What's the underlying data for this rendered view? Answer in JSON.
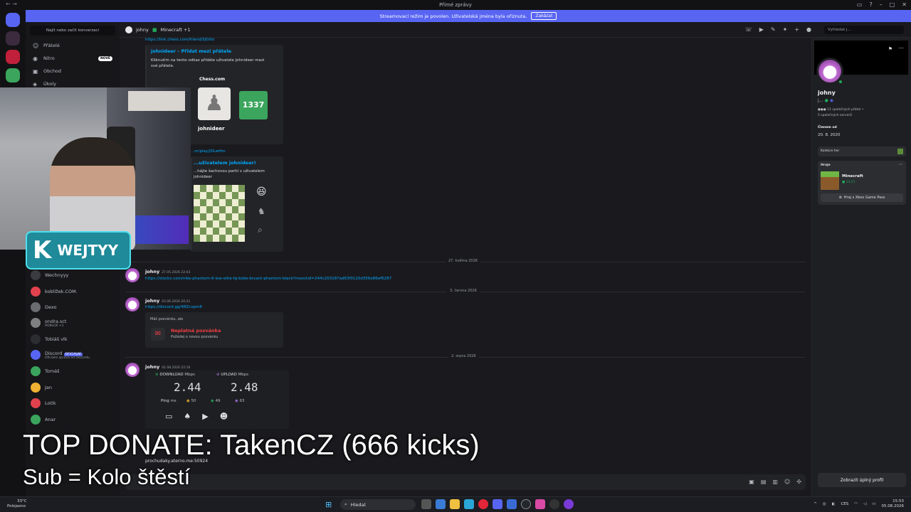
{
  "window": {
    "title": "Přímé zprávy"
  },
  "banner": {
    "text": "Streamovací režim je povolen. Uživatelská jména byla ořiznuta.",
    "button": "Zakázat"
  },
  "sidebar": {
    "search_placeholder": "Najít nebo začít konverzaci",
    "nav": [
      {
        "label": "Přátelé",
        "icon": "friends-icon"
      },
      {
        "label": "Nitro",
        "icon": "nitro-icon",
        "badge": "NOVÉ"
      },
      {
        "label": "Obchod",
        "icon": "shop-icon"
      },
      {
        "label": "Úkoly",
        "icon": "quests-icon"
      }
    ],
    "dms": [
      {
        "name": "Wechnyyy",
        "sub": "",
        "color": "#3a3b40"
      },
      {
        "name": "koblížek.COM.",
        "sub": "",
        "color": "#e0424d"
      },
      {
        "name": "Dexo",
        "sub": "",
        "color": "#6b6c70"
      },
      {
        "name": "ondra.sct",
        "sub": "ROBLOX +1",
        "color": "#7f8082"
      },
      {
        "name": "Tobiáš vlk",
        "sub": "",
        "color": "#2b2d31"
      },
      {
        "name": "Discord",
        "sub": "Oficiální zpráva od Discordu",
        "verified": "OFICIÁLNÍ",
        "color": "#5865f2"
      },
      {
        "name": "Tomáš",
        "sub": "",
        "color": "#3ba55d"
      },
      {
        "name": "Jan",
        "sub": "",
        "color": "#f0b232"
      },
      {
        "name": "Lotik",
        "sub": "",
        "color": "#e0424d"
      },
      {
        "name": "Anar",
        "sub": "",
        "color": "#3ba55d"
      }
    ]
  },
  "chat": {
    "recipient": "johny",
    "activity": "Minecraft +1",
    "search_placeholder": "Vyhledat j...",
    "messages": {
      "link1": "https://link.chess.com/friend/5JGtto",
      "embed1_title": "johnideer – Přidat mezi přátele",
      "embed1_text": "Kliknutím na tento odkaz přidáte uživatele johnideer mezi své přátele.",
      "chess_brand": "Chess.com",
      "chess_rating": "1337",
      "chess_user": "johnideer",
      "link2": "...m/play/jDLwHm",
      "embed2_title": "...uživatelem johnideer!",
      "embed2_text": "...hájte šachovou partii s uživatelem johnideer",
      "divider1": "27. května 2026",
      "msg2_author": "johny",
      "msg2_time": "27.05.2026 22:03",
      "msg2_link": "https://stockx.com/nike-phantom-6-low-elite-fg-kobe-bryant-phantom-black?msockid=244c203187ad63f0120d356e86ef6287",
      "divider2": "3. června 2026",
      "msg3_author": "johny",
      "msg3_time": "03.06.2026 20:21",
      "msg3_link": "https://discord.gg/4RZcxpm6",
      "invite_intro": "Máš pozvánku, ale",
      "invite_title": "Neplatná pozvánka",
      "invite_sub": "Požádej o novou pozvánku",
      "divider3": "2. srpna 2026",
      "msg4_author": "johny",
      "msg4_time": "02.08.2026 22:16",
      "download_label": "DOWNLOAD",
      "upload_label": "UPLOAD",
      "unit": "Mbps",
      "download_value": "2.44",
      "upload_value": "2.48",
      "ping_label": "Ping",
      "ping_unit": "ms",
      "ping_values": [
        "50",
        "49",
        "63"
      ],
      "msg5_text": "prochudaky.aterno.me:50924"
    }
  },
  "profile": {
    "name": "johny",
    "mutual_friends": "11 společných přátel",
    "mutual_servers": "5 společných serverů",
    "member_since_label": "Členem od",
    "member_since": "20. 8. 2020",
    "collections_label": "Kolekce her",
    "playing_label": "Hraje",
    "game": "Minecraft",
    "game_time": "13:21",
    "xbox_button": "Hraj s Xbox Game Pass",
    "full_profile_button": "Zobrazit úplný profil"
  },
  "overlay": {
    "top_donate": "TOP DONATE: TakenCZ (666 kicks)",
    "sub_line": "Sub = Kolo štěstí",
    "channel_logo": "WEJTYY"
  },
  "taskbar": {
    "temperature": "33°C",
    "weather": "Polojasno",
    "search": "Hledat",
    "lang": "CES",
    "time": "15:53",
    "date": "05.08.2026"
  },
  "colors": {
    "accent": "#5865f2",
    "link": "#00a8fc",
    "online": "#23a55a"
  }
}
